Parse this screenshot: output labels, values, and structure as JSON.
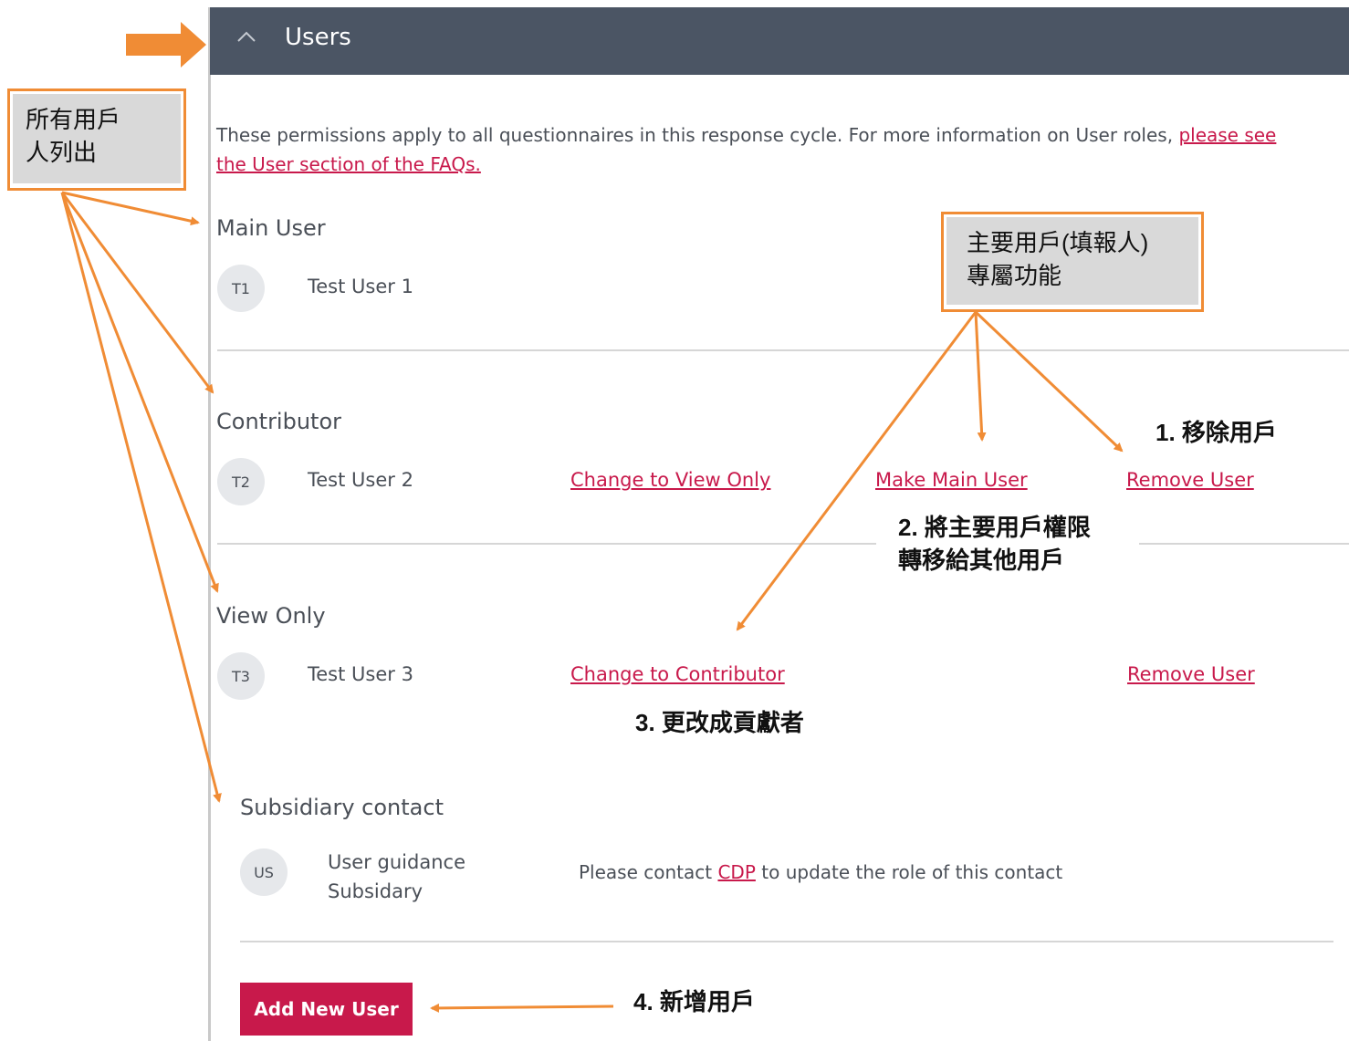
{
  "panel": {
    "title": "Users",
    "intro_text": "These permissions apply to all questionnaires in this response cycle. For more information on User roles, ",
    "intro_link_line1": "please see",
    "intro_link_line2": "the User section of the FAQs."
  },
  "sections": {
    "main_user": {
      "title": "Main User",
      "user": {
        "initials": "T1",
        "name": "Test User 1"
      }
    },
    "contributor": {
      "title": "Contributor",
      "user": {
        "initials": "T2",
        "name": "Test User 2"
      },
      "actions": [
        "Change to View Only",
        "Make Main User",
        "Remove User"
      ]
    },
    "view_only": {
      "title": "View Only",
      "user": {
        "initials": "T3",
        "name": "Test User 3"
      },
      "actions": [
        "Change to Contributor",
        "Remove User"
      ]
    },
    "subsidiary": {
      "title": "Subsidiary contact",
      "user": {
        "initials": "US",
        "name_line1": "User guidance",
        "name_line2": "Subsidary"
      },
      "contact_prefix": "Please contact ",
      "contact_link": "CDP",
      "contact_suffix": " to update the role of this contact"
    }
  },
  "add_button": "Add New User",
  "annotations": {
    "all_users_line1": "所有用戶",
    "all_users_line2": "人列出",
    "main_user_only_line1": "主要用戶(填報人)",
    "main_user_only_line2": "專屬功能",
    "note1": "1. 移除用戶",
    "note2_line1": "2. 將主要用戶權限",
    "note2_line2": "轉移給其他用戶",
    "note3": "3. 更改成貢獻者",
    "note4": "4. 新增用戶"
  },
  "colors": {
    "header": "#4b5564",
    "accent": "#c8194b",
    "annotation": "#f08c35"
  }
}
